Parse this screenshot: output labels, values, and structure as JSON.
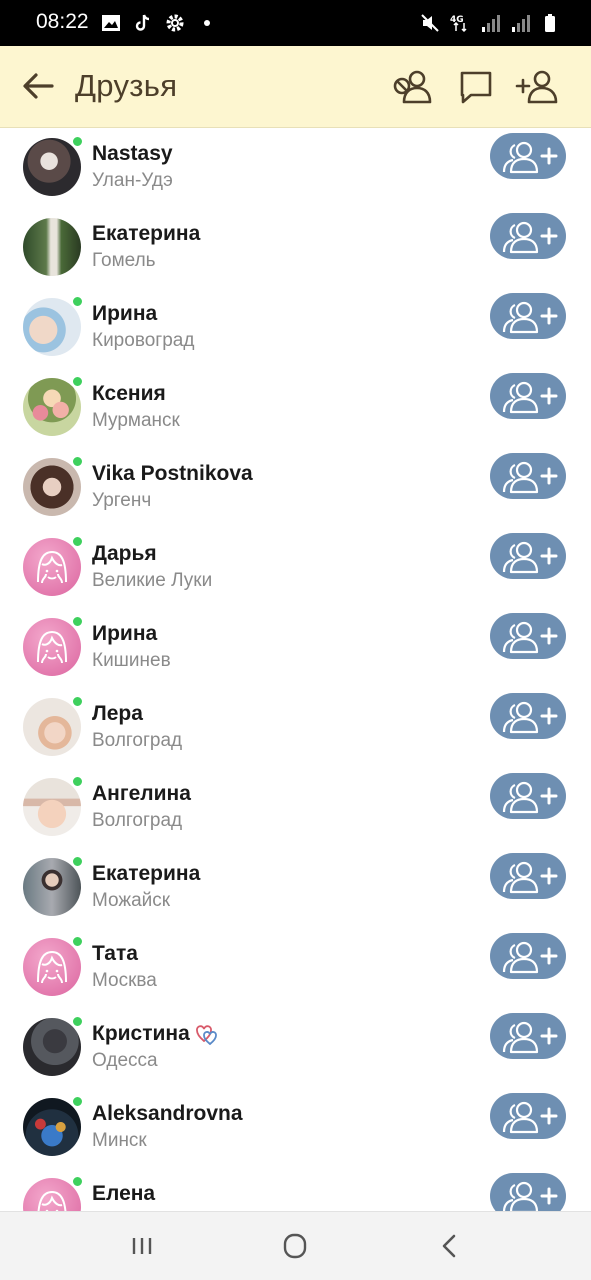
{
  "status_bar": {
    "time": "08:22",
    "left_icons": [
      "image-icon",
      "tiktok-icon",
      "gear-icon",
      "dot-icon"
    ],
    "right_icons": [
      "mute-icon",
      "4g-signal-icon",
      "signal-icon",
      "signal-icon",
      "battery-icon"
    ]
  },
  "header": {
    "title": "Друзья",
    "back_icon": "arrow-left-icon",
    "actions": [
      "friends-mutual-icon",
      "messages-icon",
      "add-friend-icon"
    ]
  },
  "colors": {
    "header_bg": "#fdf6d0",
    "header_text": "#4d3f2a",
    "add_button": "#6e8fb2",
    "online": "#3ed05d"
  },
  "friends": [
    {
      "name": "Nastasy",
      "city": "Улан-Удэ",
      "online": true
    },
    {
      "name": "Екатерина",
      "city": "Гомель",
      "online": false
    },
    {
      "name": "Ирина",
      "city": "Кировоград",
      "online": true
    },
    {
      "name": "Ксения",
      "city": "Мурманск",
      "online": true
    },
    {
      "name": "Vika Postnikova",
      "city": "Ургенч",
      "online": true
    },
    {
      "name": "Дарья",
      "city": "Великие Луки",
      "online": true
    },
    {
      "name": "Ирина",
      "city": "Кишинев",
      "online": true
    },
    {
      "name": "Лера",
      "city": "Волгоград",
      "online": true
    },
    {
      "name": "Ангелина",
      "city": "Волгоград",
      "online": true
    },
    {
      "name": "Екатерина",
      "city": "Можайск",
      "online": true
    },
    {
      "name": "Тата",
      "city": "Москва",
      "online": true
    },
    {
      "name": "Кристина",
      "city": "Одесса",
      "online": true,
      "badge": "hearts-icon"
    },
    {
      "name": "Aleksandrovna",
      "city": "Минск",
      "online": true
    },
    {
      "name": "Елена",
      "city": "",
      "online": true
    }
  ],
  "nav_bar": {
    "buttons": [
      "recent-apps-icon",
      "home-icon",
      "back-icon"
    ]
  }
}
